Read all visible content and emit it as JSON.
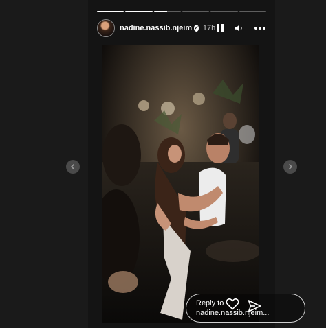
{
  "story": {
    "username": "nadine.nassib.njeim",
    "verified": true,
    "time": "17h",
    "progress_segments": [
      1,
      1,
      0.5,
      0,
      0,
      0
    ]
  },
  "reply": {
    "line1": "Reply to",
    "line2": "nadine.nassib.njeim..."
  },
  "icons": {
    "pause": "pause-icon",
    "mute": "speaker-icon",
    "more": "more-options-icon",
    "like": "heart-icon",
    "share": "send-icon",
    "prev": "chevron-left-icon",
    "next": "chevron-right-icon",
    "verified": "verified-badge-icon"
  },
  "colors": {
    "background": "#1a1a1a",
    "story_bg": "#141414",
    "progress_active": "#ffffff",
    "progress_inactive": "#5e5e5e"
  }
}
